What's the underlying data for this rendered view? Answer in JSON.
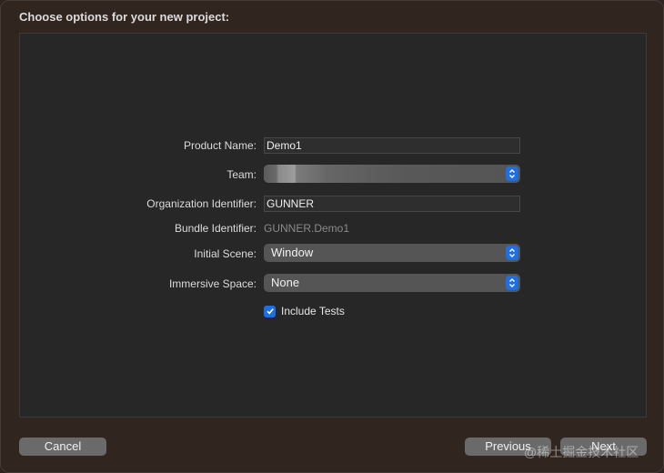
{
  "dialog": {
    "title": "Choose options for your new project:"
  },
  "form": {
    "product_name": {
      "label": "Product Name:",
      "value": "Demo1"
    },
    "team": {
      "label": "Team:"
    },
    "organization_identifier": {
      "label": "Organization Identifier:",
      "value": "GUNNER"
    },
    "bundle_identifier": {
      "label": "Bundle Identifier:",
      "value": "GUNNER.Demo1"
    },
    "initial_scene": {
      "label": "Initial Scene:",
      "value": "Window"
    },
    "immersive_space": {
      "label": "Immersive Space:",
      "value": "None"
    },
    "include_tests": {
      "label": "Include Tests",
      "checked": true
    }
  },
  "buttons": {
    "cancel": "Cancel",
    "previous": "Previous",
    "next": "Next"
  },
  "watermark": "@稀土掘金技术社区",
  "colors": {
    "accent": "#1f6fe0",
    "window_bg": "#312520",
    "panel_bg": "#272727"
  }
}
